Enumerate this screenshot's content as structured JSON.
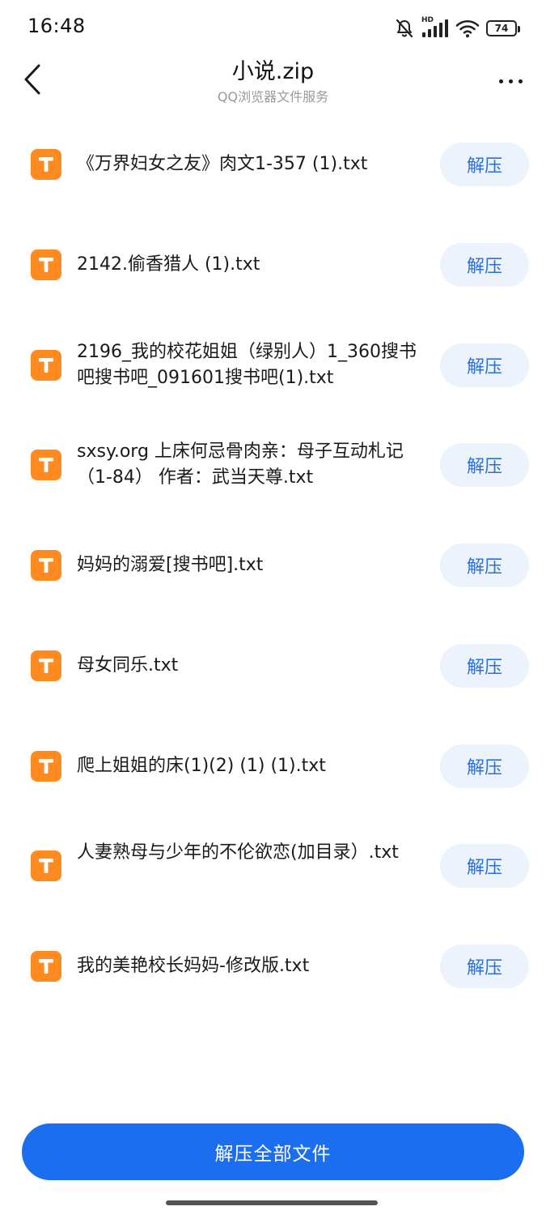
{
  "status_bar": {
    "time": "16:48",
    "network_label": "HD",
    "battery": "74",
    "icons": [
      "mute-bell-icon",
      "signal-icon",
      "wifi-icon",
      "battery-icon"
    ]
  },
  "header": {
    "title": "小说.zip",
    "subtitle": "QQ浏览器文件服务",
    "icons": [
      "back-arrow-icon",
      "more-dots-icon"
    ]
  },
  "files": [
    {
      "name": "《万界妇女之友》肉文1-357 (1).txt",
      "action": "解压",
      "icon_letter": "T"
    },
    {
      "name": "2142.偷香猎人 (1).txt",
      "action": "解压",
      "icon_letter": "T"
    },
    {
      "name": "2196_我的校花姐姐（绿别人）1_360搜书吧搜书吧_091601搜书吧(1).txt",
      "action": "解压",
      "icon_letter": "T"
    },
    {
      "name": "sxsy.org 上床何忌骨肉亲：母子互动札记（1-84） 作者：武当天尊.txt",
      "action": "解压",
      "icon_letter": "T"
    },
    {
      "name": "妈妈的溺爱[搜书吧].txt",
      "action": "解压",
      "icon_letter": "T"
    },
    {
      "name": "母女同乐.txt",
      "action": "解压",
      "icon_letter": "T"
    },
    {
      "name": "爬上姐姐的床(1)(2) (1) (1).txt",
      "action": "解压",
      "icon_letter": "T"
    },
    {
      "name": "人妻熟母与少年的不伦欲恋(加目录）.txt",
      "action": "解压",
      "icon_letter": "T"
    },
    {
      "name": "我的美艳校长妈妈-修改版.txt",
      "action": "解压",
      "icon_letter": "T"
    }
  ],
  "footer": {
    "extract_all_label": "解压全部文件"
  },
  "colors": {
    "accent": "#1b6ef0",
    "file_icon": "#ff8a1f",
    "extract_button_bg": "#ecf3fd",
    "extract_button_text": "#2a6fe0"
  }
}
